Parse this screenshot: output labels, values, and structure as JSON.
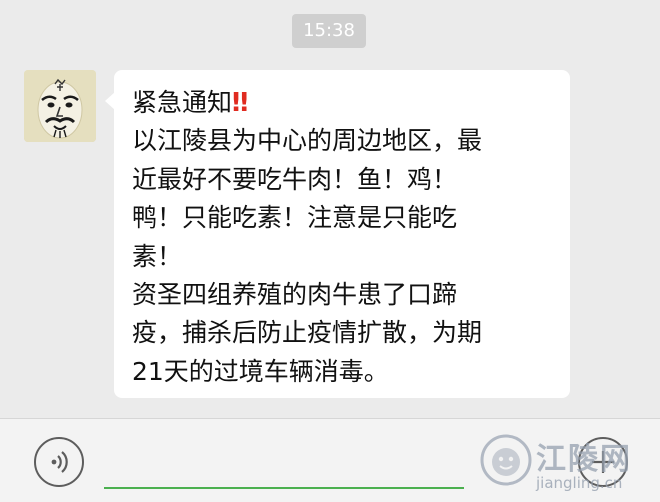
{
  "chat": {
    "timestamp": "15:38",
    "message": {
      "alert_icon": "double-exclamation-icon",
      "lines": [
        "紧急通知",
        "以江陵县为中心的周边地区，最",
        "近最好不要吃牛肉！鱼！鸡！",
        "鸭！只能吃素！注意是只能吃",
        "素！",
        "资圣四组养殖的肉牛患了口蹄",
        "疫，捕杀后防止疫情扩散，为期",
        "21天的过境车辆消毒。"
      ]
    }
  },
  "input_bar": {
    "voice_icon": "voice-icon",
    "plus_icon": "plus-icon"
  },
  "watermark": {
    "name": "江陵网",
    "url": "jiangling.cn"
  },
  "colors": {
    "chat_background": "#ebebeb",
    "bubble": "#ffffff",
    "timestamp_badge": "#cfcfcf",
    "alert": "#e02b20",
    "input_underline": "#4bb04f"
  }
}
